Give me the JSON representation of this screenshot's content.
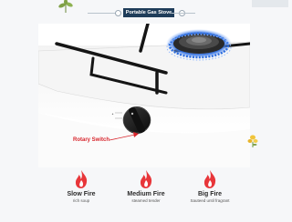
{
  "header": {
    "title": "Portable Gas Stove"
  },
  "callout": {
    "label": "Rotary Switch"
  },
  "levels": [
    {
      "name": "Slow Fire",
      "desc": "rich soup",
      "icon": "flame-icon"
    },
    {
      "name": "Medium Fire",
      "desc": "steamed tender",
      "icon": "flame-icon"
    },
    {
      "name": "Big Fire",
      "desc": "Sauteed until fragrant",
      "icon": "flame-icon"
    }
  ],
  "colors": {
    "accent_red": "#d8262d",
    "title_bg": "#1f3d5a",
    "flame_blue": "#2f6fe0"
  }
}
